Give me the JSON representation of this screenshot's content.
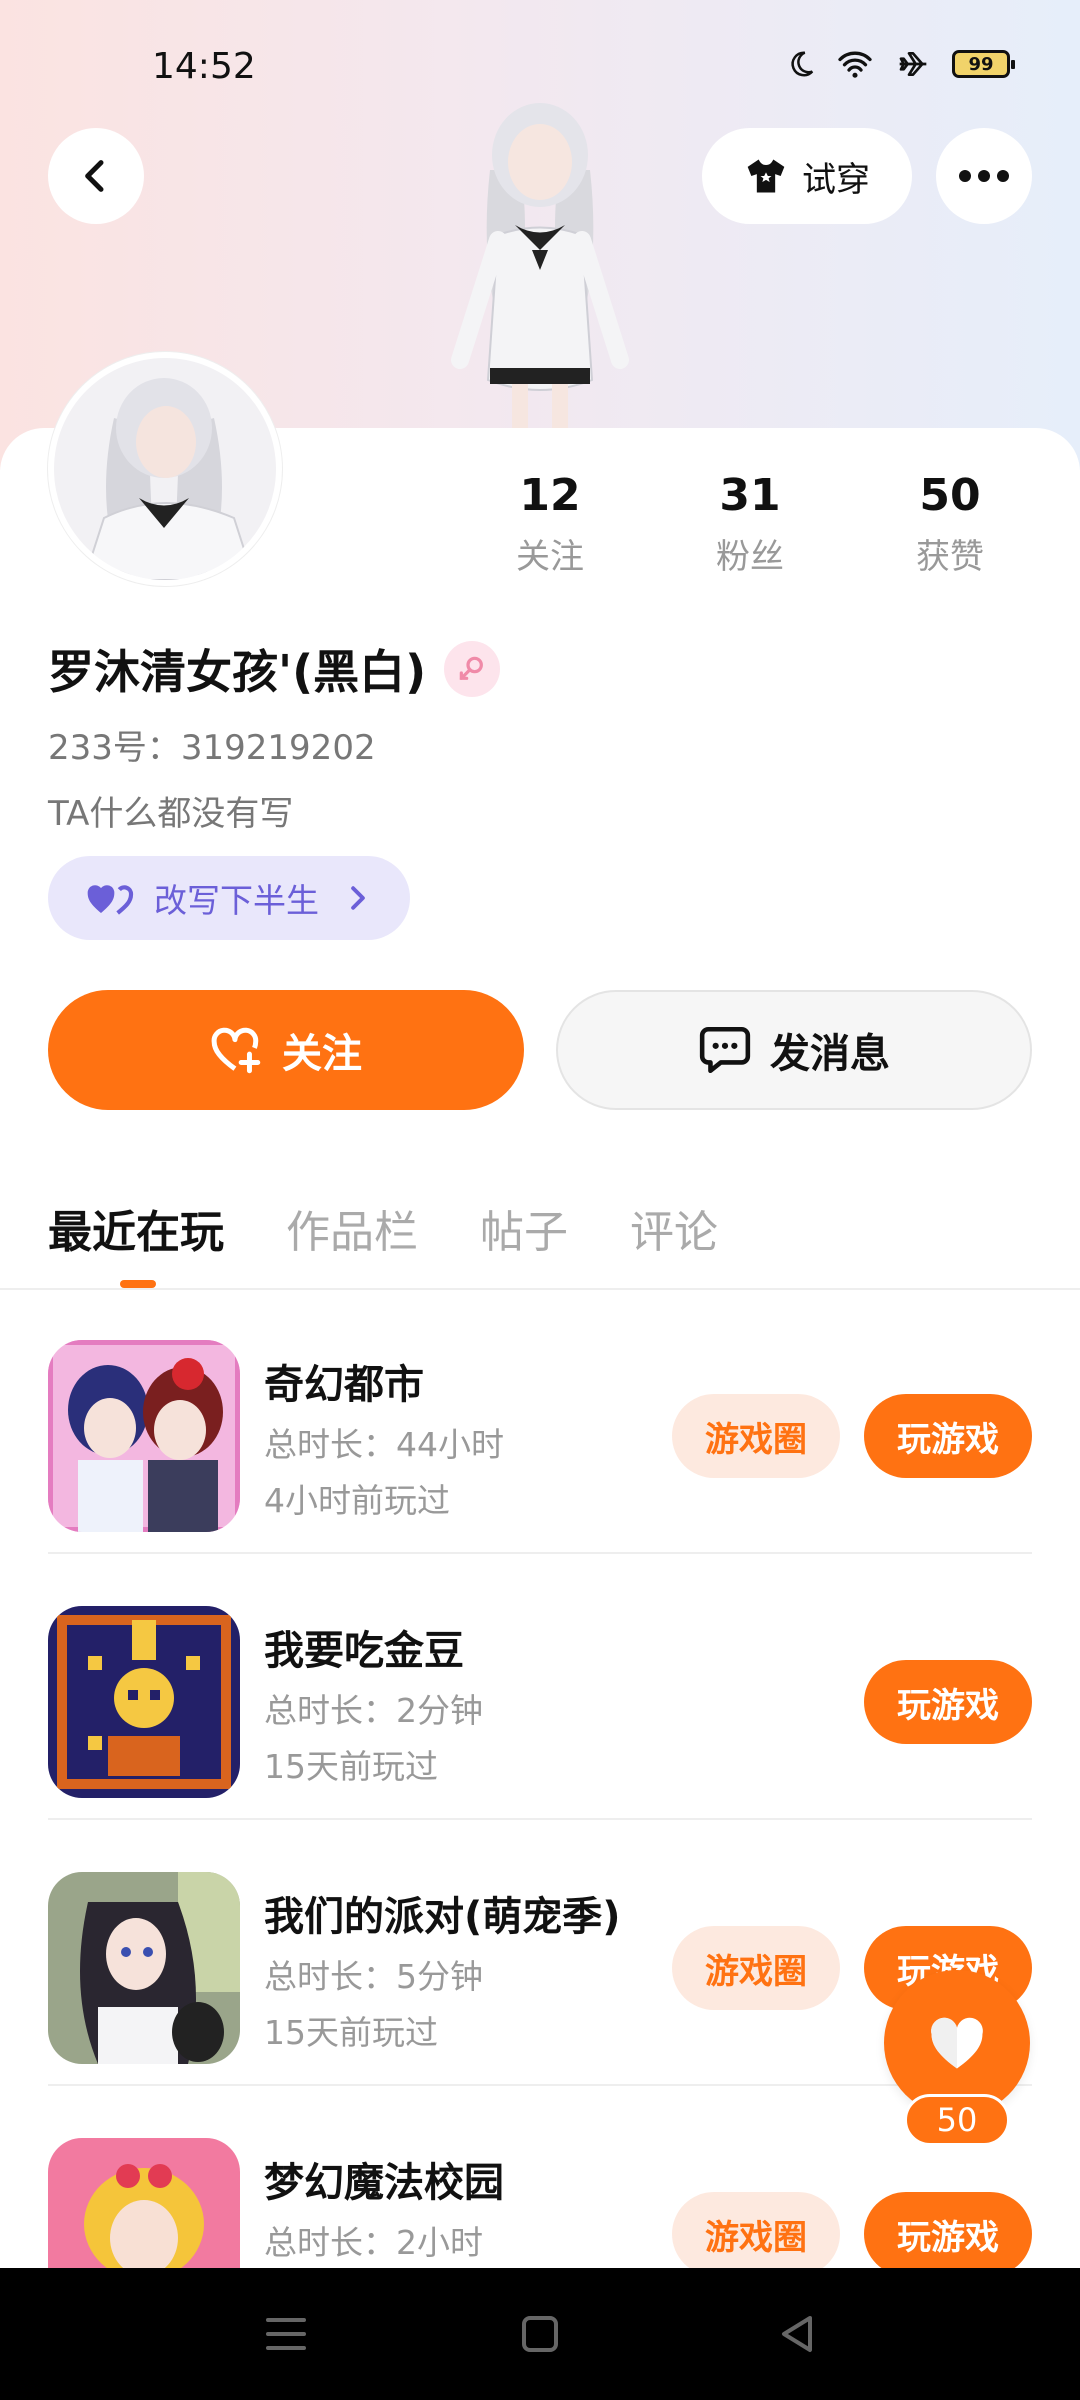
{
  "status": {
    "time": "14:52",
    "battery": "99"
  },
  "header": {
    "tryon_label": "试穿"
  },
  "stats": [
    {
      "value": "12",
      "label": "关注"
    },
    {
      "value": "31",
      "label": "粉丝"
    },
    {
      "value": "50",
      "label": "获赞"
    }
  ],
  "profile": {
    "name": "罗沐清女孩'(黑白)",
    "uid": "233号：319219202",
    "bio": "TA什么都没有写",
    "tag": "改写下半生"
  },
  "actions": {
    "follow": "关注",
    "message": "发消息"
  },
  "tabs": [
    "最近在玩",
    "作品栏",
    "帖子",
    "评论"
  ],
  "games": [
    {
      "title": "奇幻都市",
      "duration": "总时长：44小时",
      "last_played": "4小时前玩过",
      "circle": "游戏圈",
      "play": "玩游戏"
    },
    {
      "title": "我要吃金豆",
      "duration": "总时长：2分钟",
      "last_played": "15天前玩过",
      "play": "玩游戏"
    },
    {
      "title": "我们的派对(萌宠季)",
      "duration": "总时长：5分钟",
      "last_played": "15天前玩过",
      "circle": "游戏圈",
      "play": "玩游戏"
    },
    {
      "title": "梦幻魔法校园",
      "duration": "总时长：2小时",
      "circle": "游戏圈",
      "play": "玩游戏"
    }
  ],
  "fab": {
    "count": "50"
  },
  "colors": {
    "accent": "#ff7212",
    "tag_bg": "#e9e7fb",
    "tag_text": "#6b5fd8"
  }
}
